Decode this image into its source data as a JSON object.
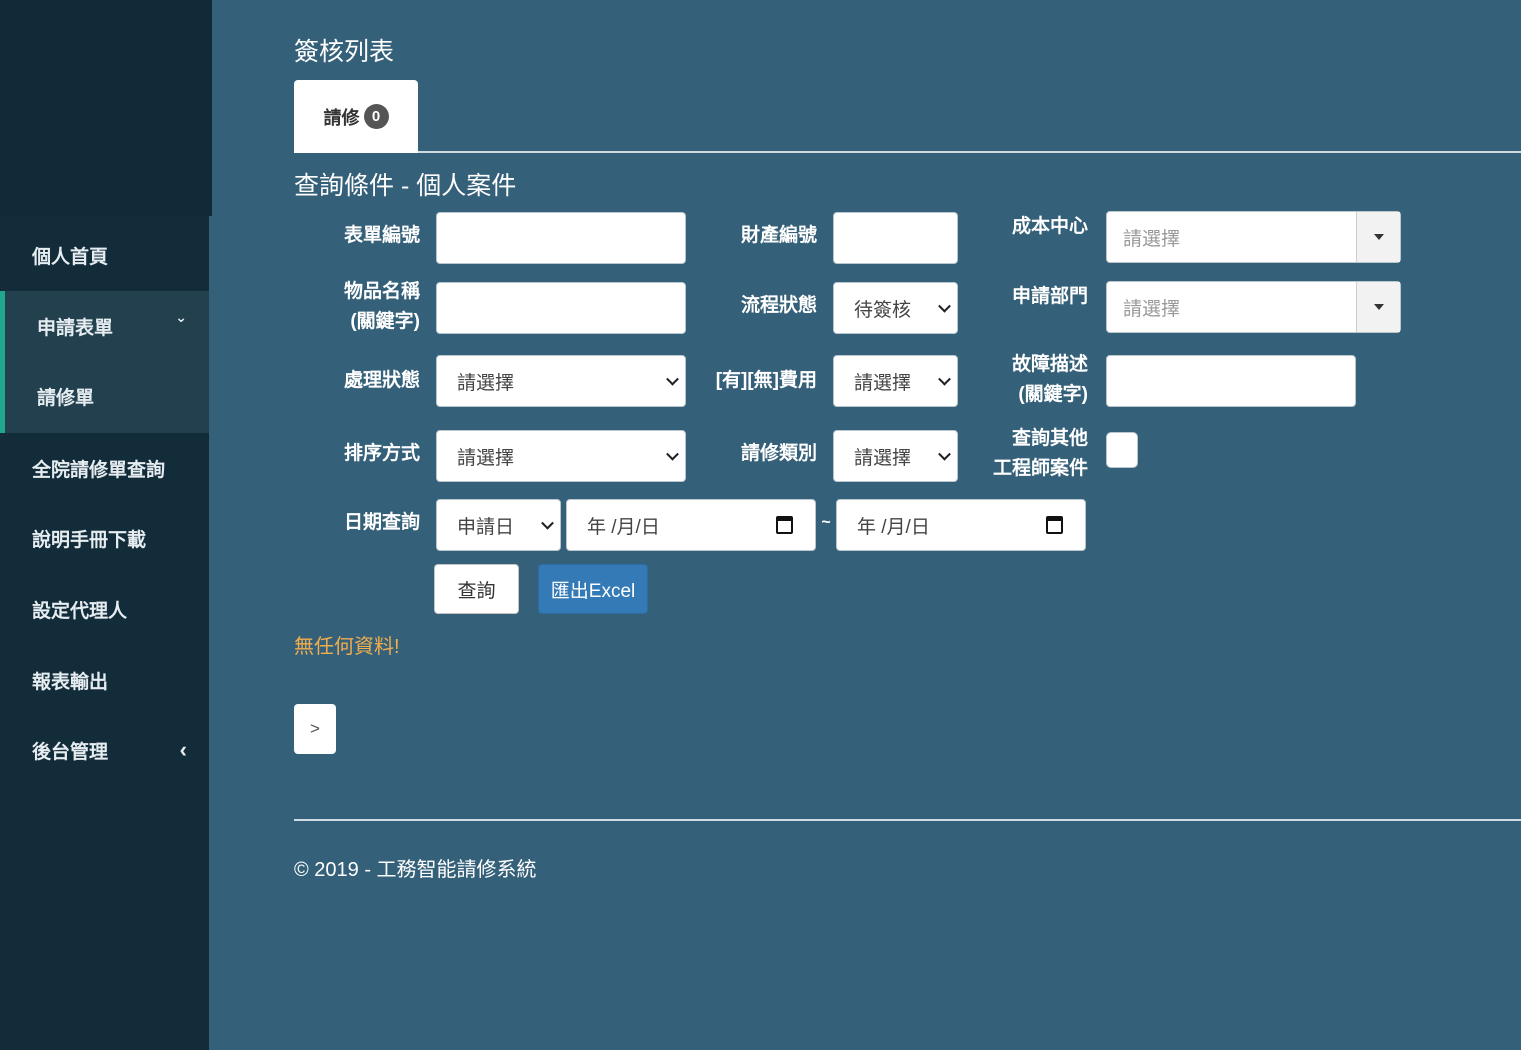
{
  "sidebar": {
    "items": [
      {
        "label": "個人首頁"
      },
      {
        "label": "申請表單"
      },
      {
        "label": "請修單"
      },
      {
        "label": "全院請修單查詢"
      },
      {
        "label": "說明手冊下載"
      },
      {
        "label": "設定代理人"
      },
      {
        "label": "報表輸出"
      },
      {
        "label": "後台管理"
      }
    ],
    "chevron_down": "⌄",
    "chevron_left": "‹"
  },
  "main": {
    "title": "簽核列表",
    "tab": {
      "label": "請修",
      "badge": "0"
    },
    "section_title": "查詢條件 - 個人案件"
  },
  "form": {
    "form_no": {
      "label": "表單編號",
      "value": ""
    },
    "asset_no": {
      "label": "財產編號",
      "value": ""
    },
    "cost_center": {
      "label": "成本中心",
      "placeholder": "請選擇"
    },
    "item_name": {
      "label1": "物品名稱",
      "label2": "(關鍵字)",
      "value": ""
    },
    "flow_status": {
      "label": "流程狀態",
      "value": "待簽核"
    },
    "apply_dept": {
      "label": "申請部門",
      "placeholder": "請選擇"
    },
    "process_status": {
      "label": "處理狀態",
      "value": "請選擇"
    },
    "fee": {
      "label": "[有][無]費用",
      "value": "請選擇"
    },
    "fault_desc": {
      "label1": "故障描述",
      "label2": "(關鍵字)",
      "value": ""
    },
    "sort": {
      "label": "排序方式",
      "value": "請選擇"
    },
    "repair_type": {
      "label": "請修類別",
      "value": "請選擇"
    },
    "other_eng": {
      "label1": "查詢其他",
      "label2": "工程師案件"
    },
    "date": {
      "label": "日期查詢",
      "type_value": "申請日",
      "from_placeholder": "年 /月/日",
      "to_placeholder": "年 /月/日",
      "sep": "~"
    }
  },
  "buttons": {
    "search": "查詢",
    "excel": "匯出Excel",
    "next": ">"
  },
  "message": "無任何資料!",
  "footer": "© 2019 - 工務智能請修系統"
}
